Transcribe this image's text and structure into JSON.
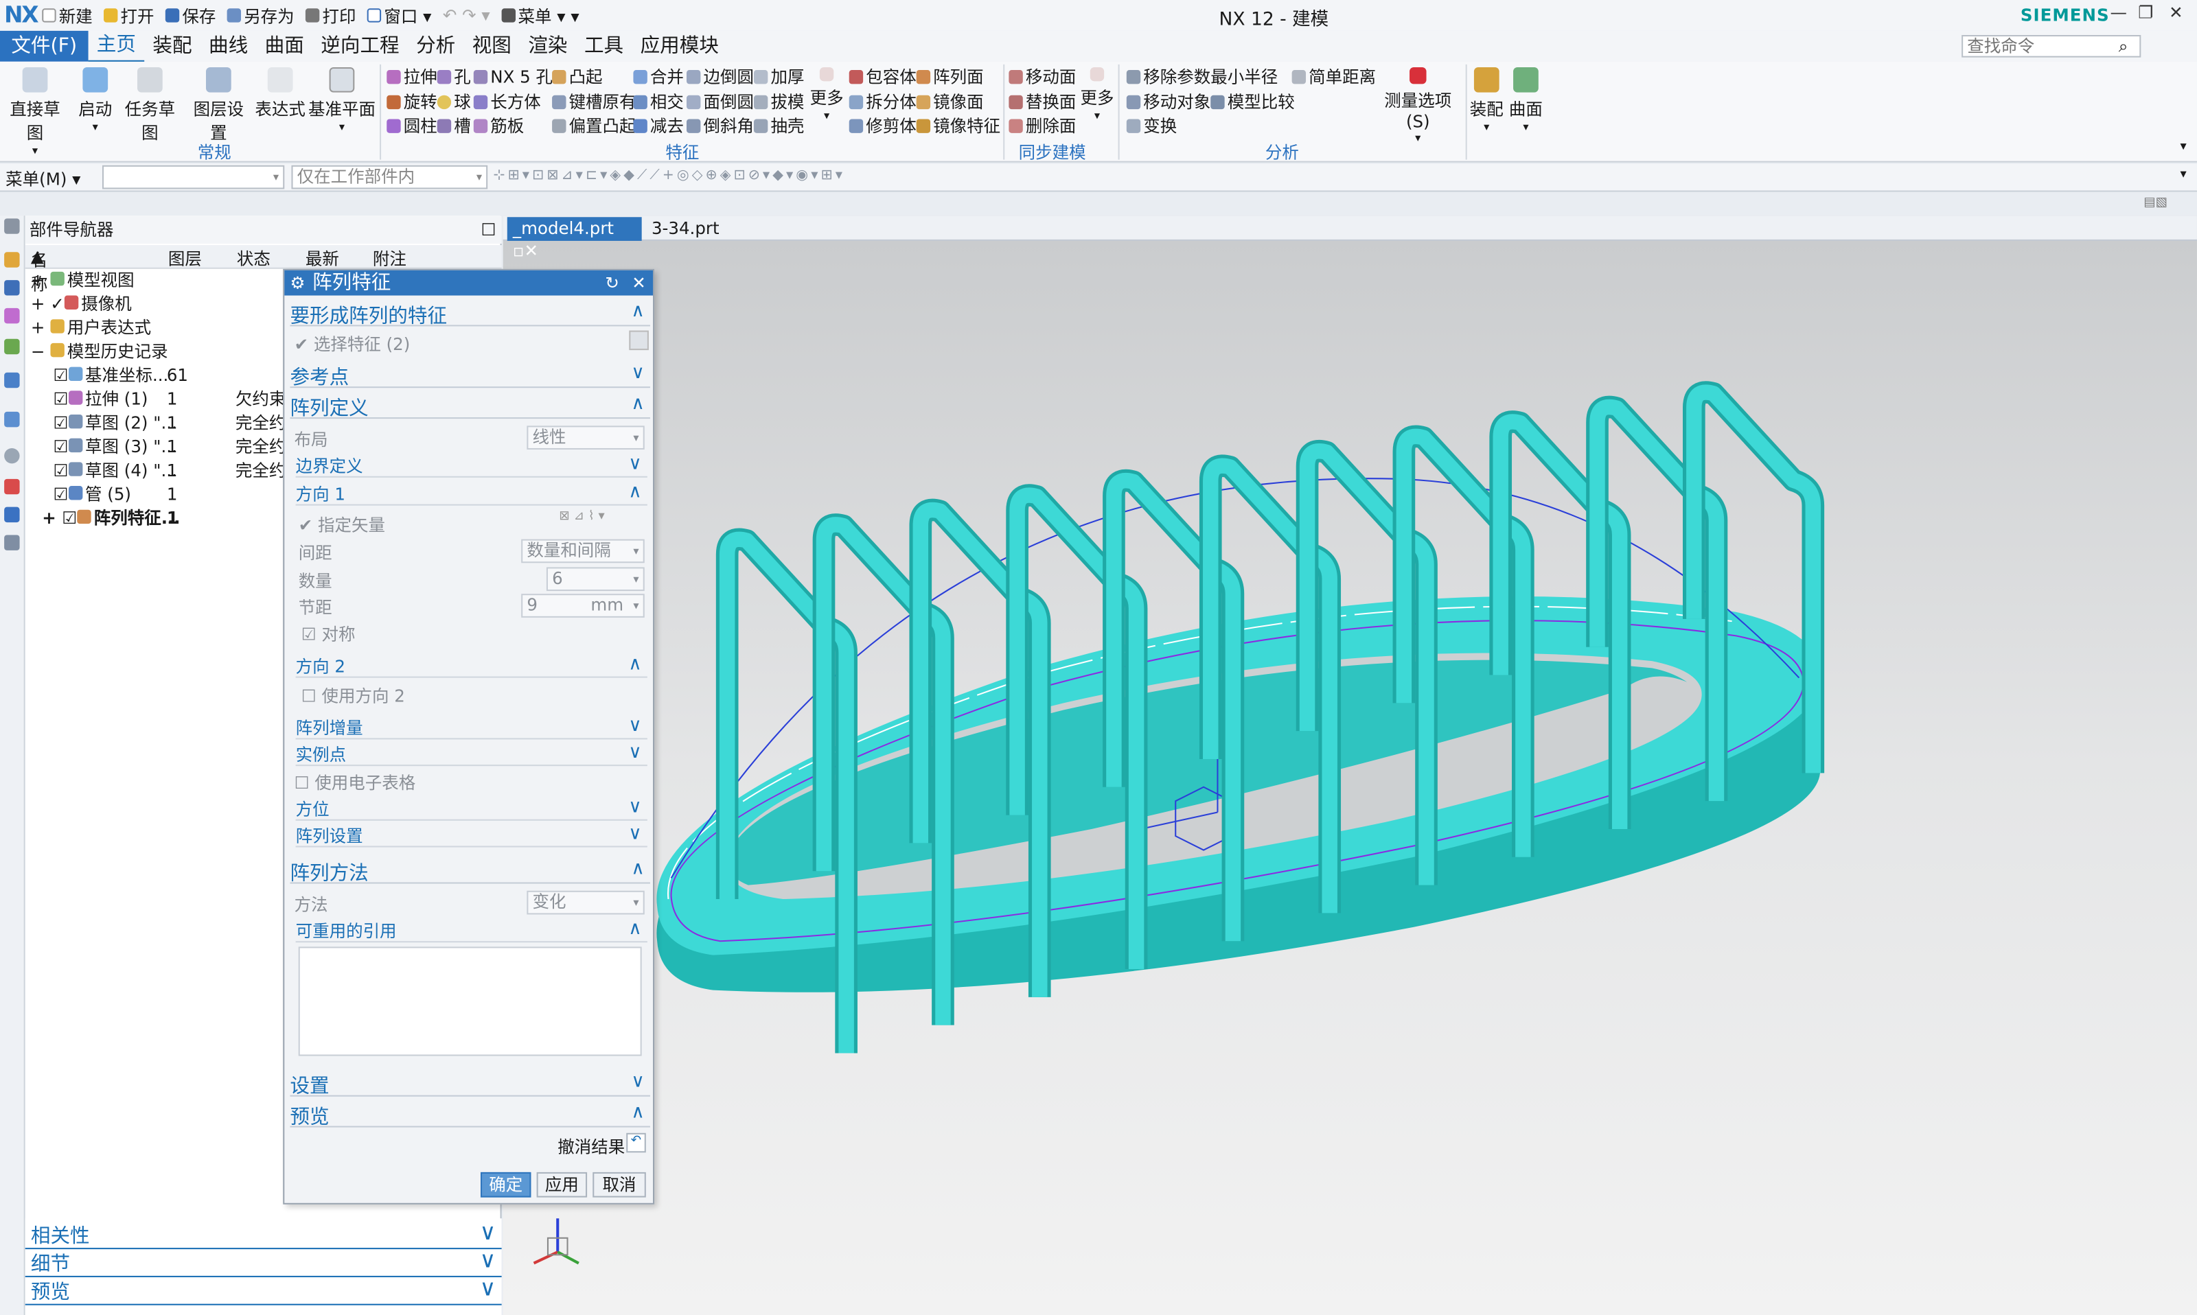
{
  "titlebar": {
    "logo": "NX",
    "title": "NX 12 - 建模",
    "brand": "SIEMENS",
    "qat": [
      "新建",
      "打开",
      "保存",
      "另存为",
      "打印",
      "窗口",
      "菜单"
    ]
  },
  "menubar": {
    "items": [
      "文件(F)",
      "主页",
      "装配",
      "曲线",
      "曲面",
      "逆向工程",
      "分析",
      "视图",
      "渲染",
      "工具",
      "应用模块"
    ],
    "search_placeholder": "查找命令"
  },
  "ribbon": {
    "big": [
      "直接草图",
      "启动",
      "任务草图",
      "图层设置",
      "表达式",
      "基准平面"
    ],
    "group_normal": "常规",
    "feature_col1": [
      "拉伸",
      "旋转",
      "圆柱"
    ],
    "feature_col2": [
      "孔",
      "球",
      "槽"
    ],
    "feature_col3": [
      "NX 5 孔",
      "长方体",
      "筋板"
    ],
    "feature_col4": [
      "凸起",
      "键槽原有",
      "偏置凸起"
    ],
    "feature_col5": [
      "合并",
      "相交",
      "减去"
    ],
    "feature_col6": [
      "边倒圆",
      "面倒圆",
      "倒斜角"
    ],
    "feature_col7": [
      "加厚",
      "拔模",
      "抽壳"
    ],
    "more1": "更多",
    "feature_col8": [
      "包容体",
      "拆分体",
      "修剪体"
    ],
    "feature_col9": [
      "阵列面",
      "镜像面",
      "镜像特征"
    ],
    "group_feature": "特征",
    "sync": [
      "移动面",
      "替换面",
      "删除面"
    ],
    "more2": "更多",
    "group_sync": "同步建模",
    "analysis1": [
      "移除参数",
      "移动对象",
      "变换"
    ],
    "analysis2": [
      "最小半径",
      "模型比较"
    ],
    "analysis3": "简单距离",
    "measure": "测量选项(S)",
    "group_analysis": "分析",
    "assembly": "装配",
    "surface": "曲面"
  },
  "toolbar2": {
    "menu": "菜单(M)",
    "filter": "仅在工作部件内"
  },
  "navigator": {
    "title": "部件导航器",
    "columns": [
      "名称",
      "图层",
      "状态",
      "最新",
      "附注"
    ],
    "rows": [
      {
        "name": "模型视图",
        "layer": "",
        "status": ""
      },
      {
        "name": "摄像机",
        "layer": "",
        "status": ""
      },
      {
        "name": "用户表达式",
        "layer": "",
        "status": ""
      },
      {
        "name": "模型历史记录",
        "layer": "",
        "status": ""
      },
      {
        "name": "基准坐标...",
        "layer": "61",
        "status": ""
      },
      {
        "name": "拉伸 (1)",
        "layer": "1",
        "status": "欠约束"
      },
      {
        "name": "草图 (2) \"...",
        "layer": "1",
        "status": "完全约"
      },
      {
        "name": "草图 (3) \"...",
        "layer": "1",
        "status": "完全约"
      },
      {
        "name": "草图 (4) \"...",
        "layer": "1",
        "status": "完全约"
      },
      {
        "name": "管 (5)",
        "layer": "1",
        "status": ""
      },
      {
        "name": "阵列特征...",
        "layer": "1",
        "status": ""
      }
    ],
    "bottom": [
      "相关性",
      "细节",
      "预览"
    ]
  },
  "dialog": {
    "title": "阵列特征",
    "s_feature": "要形成阵列的特征",
    "select_feature": "选择特征 (2)",
    "s_ref": "参考点",
    "s_def": "阵列定义",
    "layout_label": "布局",
    "layout_value": "线性",
    "boundary": "边界定义",
    "dir1": "方向 1",
    "vector": "指定矢量",
    "spacing_label": "间距",
    "spacing_value": "数量和间隔",
    "count_label": "数量",
    "count_value": "6",
    "pitch_label": "节距",
    "pitch_value": "9",
    "pitch_unit": "mm",
    "symmetric": "对称",
    "dir2": "方向 2",
    "use_dir2": "使用方向 2",
    "increment": "阵列增量",
    "instance": "实例点",
    "spreadsheet": "使用电子表格",
    "orientation": "方位",
    "settings_sub": "阵列设置",
    "s_method": "阵列方法",
    "method_label": "方法",
    "method_value": "变化",
    "reuse": "可重用的引用",
    "s_settings": "设置",
    "s_preview": "预览",
    "undo": "撤消结果",
    "ok": "确定",
    "apply": "应用",
    "cancel": "取消"
  },
  "graphics": {
    "tabs": [
      "_model4.prt",
      "3-34.prt"
    ],
    "accent": "#3dd9d6"
  }
}
